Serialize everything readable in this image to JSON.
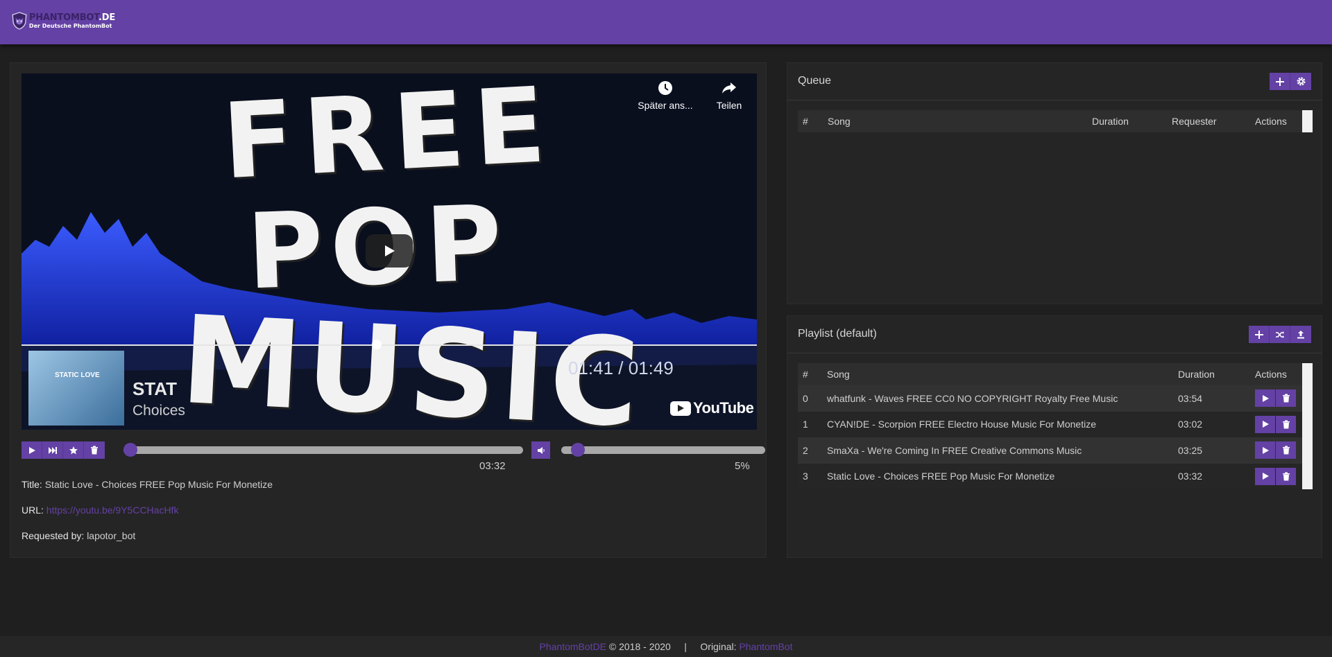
{
  "header": {
    "logo_title_a": "PHANTOMBOT",
    "logo_title_b": ".DE",
    "logo_subtitle": "Der Deutsche PhantomBot"
  },
  "player": {
    "overlay": {
      "watch_later_label": "Später ans...",
      "share_label": "Teilen",
      "video_text_line1": "FREE",
      "video_text_line2": "POP",
      "video_text_line3": "MUSIC",
      "time_display": "01:41 / 01:49",
      "youtube_label": "YouTube",
      "thumbnail_text": "STATIC LOVE",
      "artist_text": "STAT",
      "track_text": "Choices"
    },
    "progress_time": "03:32",
    "progress_fraction": 0.0,
    "volume_label": "5%",
    "volume_fraction": 0.05,
    "title_label": "Title:",
    "title_value": "Static Love - Choices FREE Pop Music For Monetize",
    "url_label": "URL:",
    "url_value": "https://youtu.be/9Y5CCHacHfk",
    "requested_label": "Requested by:",
    "requested_value": "lapotor_bot"
  },
  "queue": {
    "title": "Queue",
    "columns": [
      "#",
      "Song",
      "Duration",
      "Requester",
      "Actions"
    ],
    "rows": []
  },
  "playlist": {
    "title": "Playlist (default)",
    "columns": [
      "#",
      "Song",
      "Duration",
      "Actions"
    ],
    "rows": [
      {
        "index": "0",
        "song": "whatfunk - Waves FREE CC0 NO COPYRIGHT Royalty Free Music",
        "duration": "03:54"
      },
      {
        "index": "1",
        "song": "CYAN!DE - Scorpion FREE Electro House Music For Monetize",
        "duration": "03:02"
      },
      {
        "index": "2",
        "song": "SmaXa - We're Coming In FREE Creative Commons Music",
        "duration": "03:25"
      },
      {
        "index": "3",
        "song": "Static Love - Choices FREE Pop Music For Monetize",
        "duration": "03:32"
      }
    ]
  },
  "footer": {
    "brand": "PhantomBotDE",
    "copyright": "© 2018 - 2020",
    "separator": "|",
    "original_label": "Original:",
    "original_link": "PhantomBot"
  },
  "colors": {
    "accent": "#6441a5",
    "background": "#1f1f1f",
    "panel": "#252525"
  }
}
